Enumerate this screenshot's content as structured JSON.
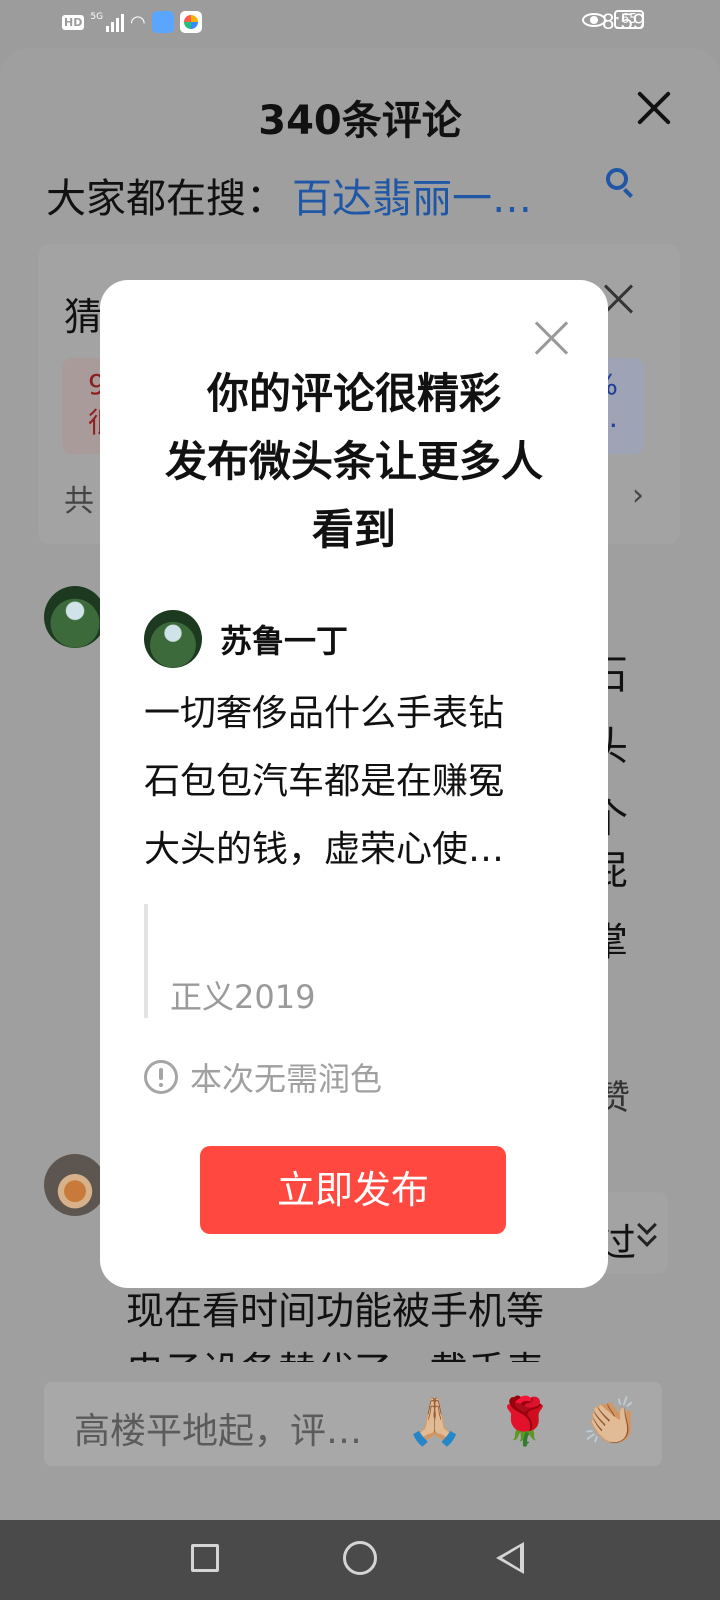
{
  "status_bar": {
    "hd": "HD",
    "network": "5G",
    "battery": "65",
    "time": "8:59",
    "icons": [
      "signal-icon",
      "wifi-icon",
      "cloud-app-icon",
      "pinwheel-app-icon",
      "eye-icon"
    ]
  },
  "comments_sheet": {
    "title": "340条评论",
    "search_label": "大家都在搜：",
    "search_keyword": "百达翡丽一…",
    "guess_card": {
      "title_fragment": "猜",
      "option_left_fragment": "9",
      "option_left_fragment2": "很",
      "option_right_fragment": "%",
      "option_right_fragment2": "…",
      "footer_fragment": "共"
    },
    "background_comment_fragments": [
      "石",
      "头",
      "个",
      "屁",
      "掌"
    ],
    "like_label": "赞",
    "expand_label_fragment": "过",
    "bottom_comment_line": "现在看时间功能被手机等",
    "bottom_comment_cut": "电子设备替代了，戴手表"
  },
  "reply_bar": {
    "placeholder": "高楼平地起，评…",
    "emoji": [
      "🙏🏼",
      "🌹",
      "👏🏼"
    ]
  },
  "modal": {
    "title_lines": [
      "你的评论很精彩",
      "发布微头条让更多人",
      "看到"
    ],
    "author": "苏鲁一丁",
    "comment_lines": [
      "一切奢侈品什么手表钻",
      "石包包汽车都是在赚冤",
      "大头的钱，虚荣心使…"
    ],
    "quote_author": "正义2019",
    "hint": "本次无需润色",
    "publish_button": "立即发布"
  },
  "colors": {
    "accent_red": "#ff4940",
    "link_blue": "#1f57a6",
    "overlay_gray": "#9c9c9c"
  }
}
